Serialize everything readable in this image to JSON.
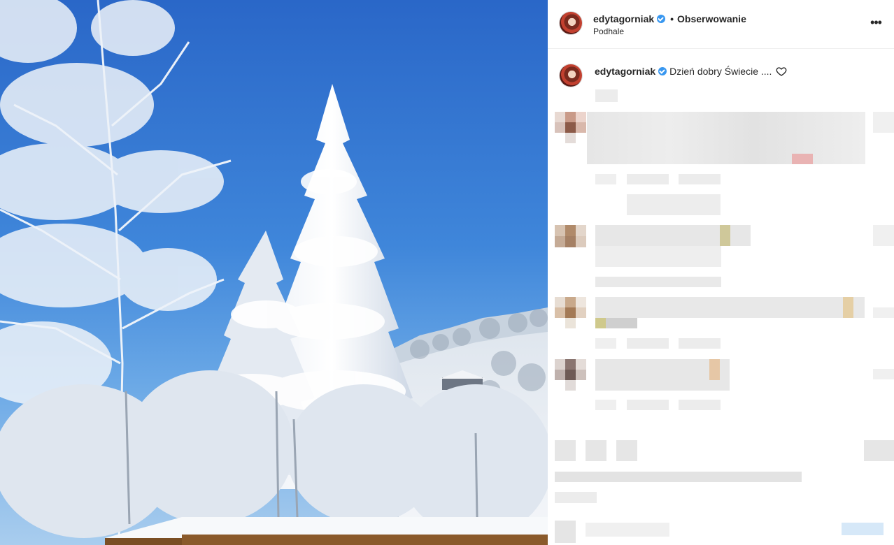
{
  "post": {
    "username": "edytagorniak",
    "verified": true,
    "separator": "•",
    "follow_label": "Obserwowanie",
    "location": "Podhale",
    "caption_text": "Dzień dobry Świecie ....",
    "more_icon": "more-horizontal-icon",
    "like_icon": "heart-outline-icon"
  },
  "colors": {
    "verified_badge": "#3897f0",
    "text": "#262626",
    "divider": "#efefef"
  }
}
